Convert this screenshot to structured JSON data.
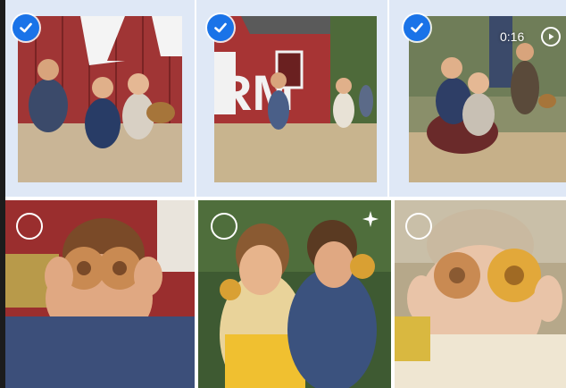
{
  "grid": {
    "tiles": [
      {
        "state": "selected",
        "subject": "kids-sitting-barn"
      },
      {
        "state": "selected",
        "subject": "kids-running-farm-sign"
      },
      {
        "state": "selected",
        "subject": "kids-wagon-ride",
        "media": "video",
        "duration": "0:16"
      },
      {
        "state": "unselected",
        "subject": "child-donut-eyes"
      },
      {
        "state": "unselected",
        "subject": "two-kids-eating-donuts",
        "badge": "sparkle-icon"
      },
      {
        "state": "unselected",
        "subject": "girl-donut-eyes"
      }
    ]
  },
  "colors": {
    "accent": "#1a73e8",
    "selected_bg": "#dfe8f6"
  }
}
